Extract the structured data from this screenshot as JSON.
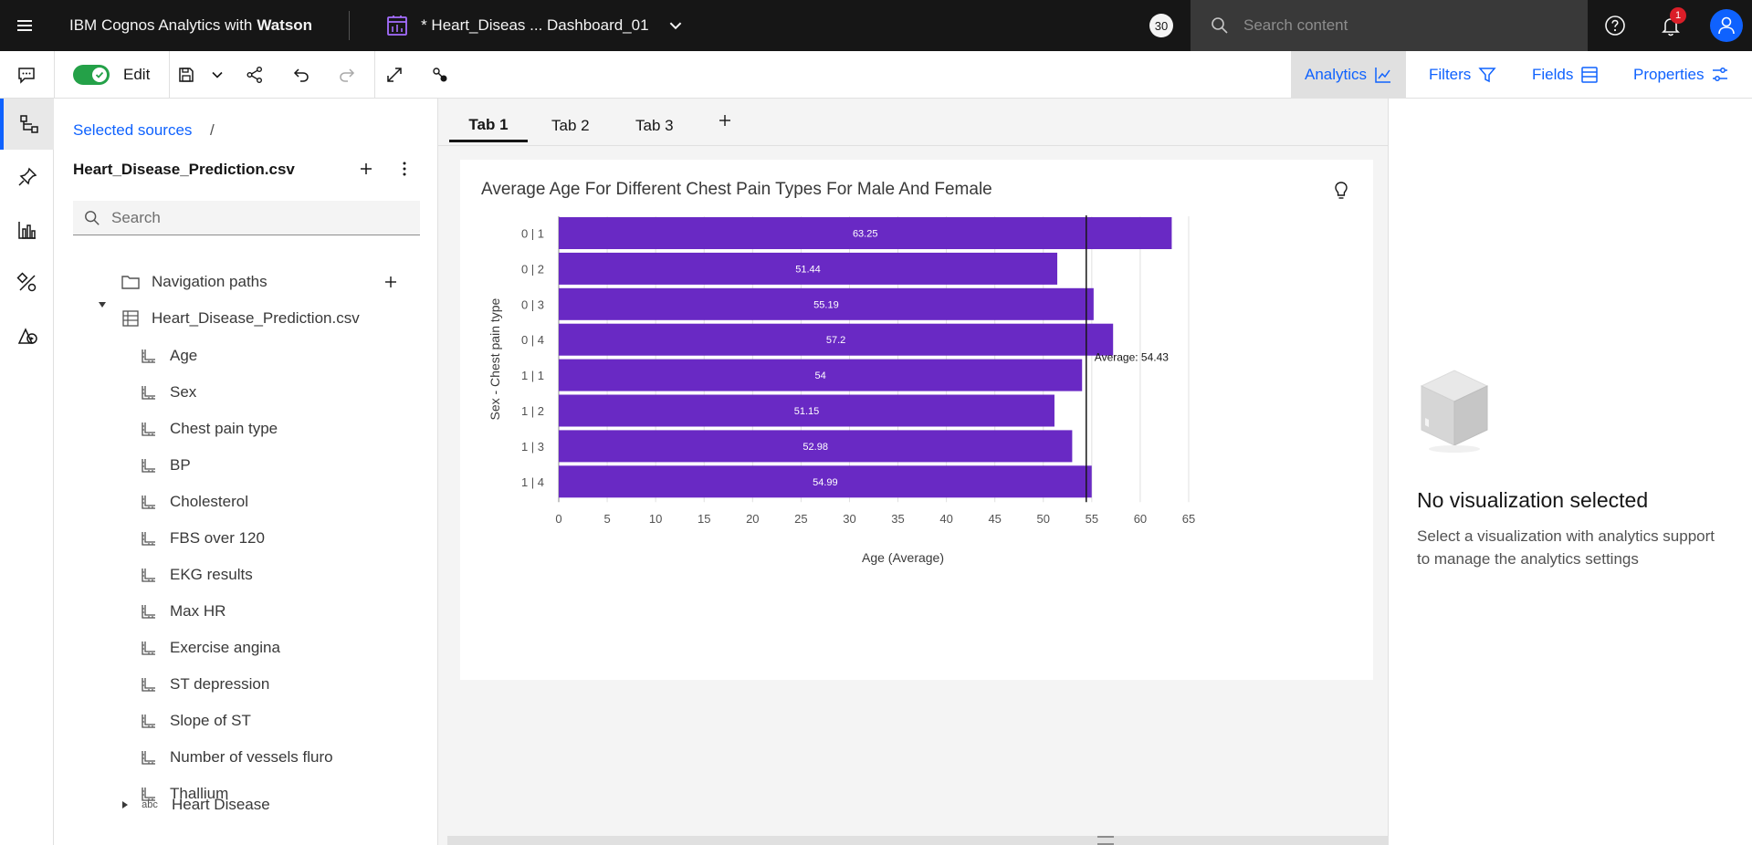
{
  "topbar": {
    "brand_prefix": "IBM Cognos Analytics with",
    "brand_bold": "Watson",
    "dashboard_title": "* Heart_Diseas ... Dashboard_01",
    "count_badge": "30",
    "search_placeholder": "Search content",
    "notification_count": "1"
  },
  "toolbar": {
    "edit_label": "Edit",
    "right_items": [
      {
        "label": "Analytics",
        "icon": "analytics-chart-icon"
      },
      {
        "label": "Filters",
        "icon": "filter-icon"
      },
      {
        "label": "Fields",
        "icon": "fields-list-icon"
      },
      {
        "label": "Properties",
        "icon": "sliders-icon"
      }
    ]
  },
  "rail": {
    "items": [
      "data-sources-icon",
      "pin-icon",
      "visualizations-icon",
      "assistant-tools-icon",
      "shapes-media-icon"
    ]
  },
  "sources": {
    "breadcrumb": "Selected sources",
    "breadcrumb_sep": "/",
    "source_name": "Heart_Disease_Prediction.csv",
    "search_placeholder": "Search",
    "navigation_paths": "Navigation paths",
    "table_name": "Heart_Disease_Prediction.csv",
    "fields": [
      "Age",
      "Sex",
      "Chest pain type",
      "BP",
      "Cholesterol",
      "FBS over 120",
      "EKG results",
      "Max HR",
      "Exercise angina",
      "ST depression",
      "Slope of ST",
      "Number of vessels fluro",
      "Thallium"
    ],
    "text_field": "Heart Disease",
    "text_field_type": "abc"
  },
  "tabs": [
    "Tab 1",
    "Tab 2",
    "Tab 3"
  ],
  "visualization": {
    "title": "Average Age For Different Chest Pain Types For Male And Female"
  },
  "chart_data": {
    "type": "bar",
    "orientation": "horizontal",
    "categories": [
      "0 | 1",
      "0 | 2",
      "0 | 3",
      "0 | 4",
      "1 | 1",
      "1 | 2",
      "1 | 3",
      "1 | 4"
    ],
    "values": [
      63.25,
      51.44,
      55.19,
      57.2,
      54,
      51.15,
      52.98,
      54.99
    ],
    "data_labels": [
      "63.25",
      "51.44",
      "55.19",
      "57.2",
      "54",
      "51.15",
      "52.98",
      "54.99"
    ],
    "xlabel": "Age (Average)",
    "ylabel": "Sex - Chest pain type",
    "xlim": [
      0,
      65
    ],
    "xticks": [
      0,
      5,
      10,
      15,
      20,
      25,
      30,
      35,
      40,
      45,
      50,
      55,
      60,
      65
    ],
    "reference_line": {
      "value": 54.43,
      "label": "Average: 54.43"
    },
    "bar_color": "#6929c4",
    "grid": true
  },
  "right_panel": {
    "title": "No visualization selected",
    "description": "Select a visualization with analytics support to manage the analytics settings"
  }
}
